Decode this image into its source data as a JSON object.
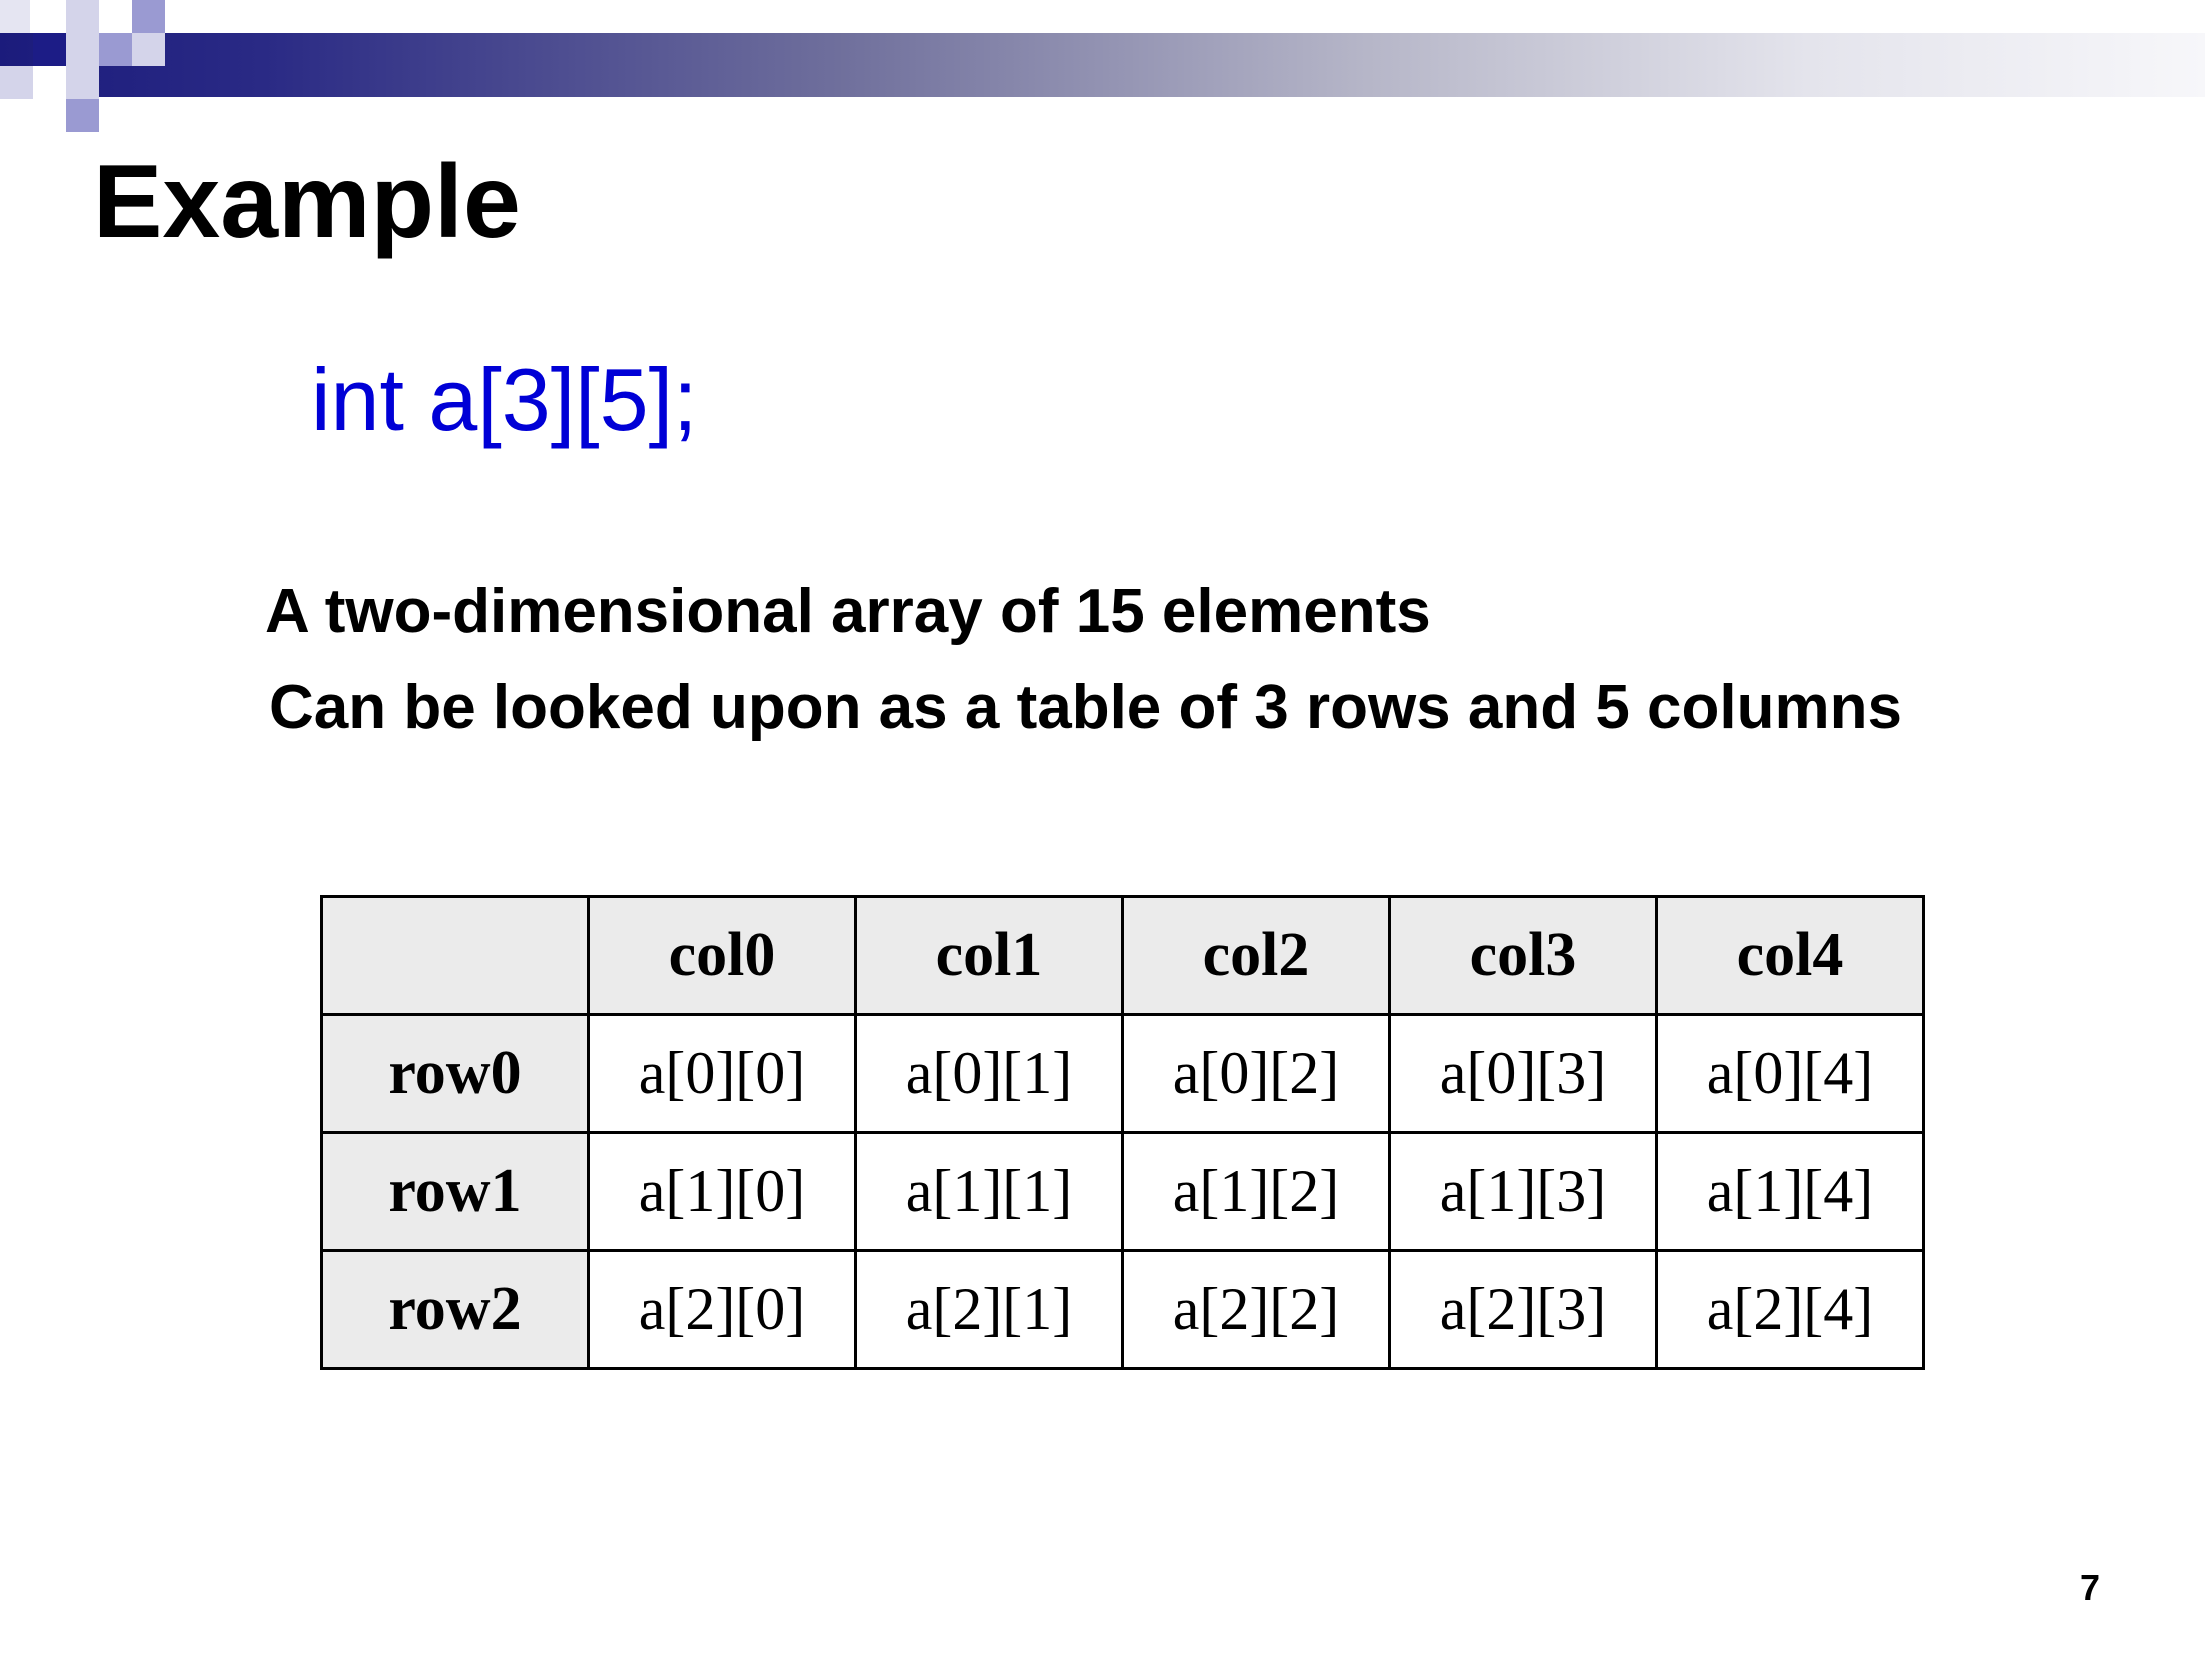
{
  "slide": {
    "title": "Example",
    "code": "int a[3][5];",
    "description": [
      "A two-dimensional array of 15 elements",
      "Can be looked upon as a table of 3 rows and 5 columns"
    ],
    "page_number": "7"
  },
  "table": {
    "corner": "",
    "columns": [
      "col0",
      "col1",
      "col2",
      "col3",
      "col4"
    ],
    "rows": [
      {
        "label": "row0",
        "cells": [
          "a[0][0]",
          "a[0][1]",
          "a[0][2]",
          "a[0][3]",
          "a[0][4]"
        ]
      },
      {
        "label": "row1",
        "cells": [
          "a[1][0]",
          "a[1][1]",
          "a[1][2]",
          "a[1][3]",
          "a[1][4]"
        ]
      },
      {
        "label": "row2",
        "cells": [
          "a[2][0]",
          "a[2][1]",
          "a[2][2]",
          "a[2][3]",
          "a[2][4]"
        ]
      }
    ]
  },
  "colors": {
    "accent": "#1c1c86",
    "code_text": "#0000d6",
    "header_fill": "#ebebeb"
  }
}
